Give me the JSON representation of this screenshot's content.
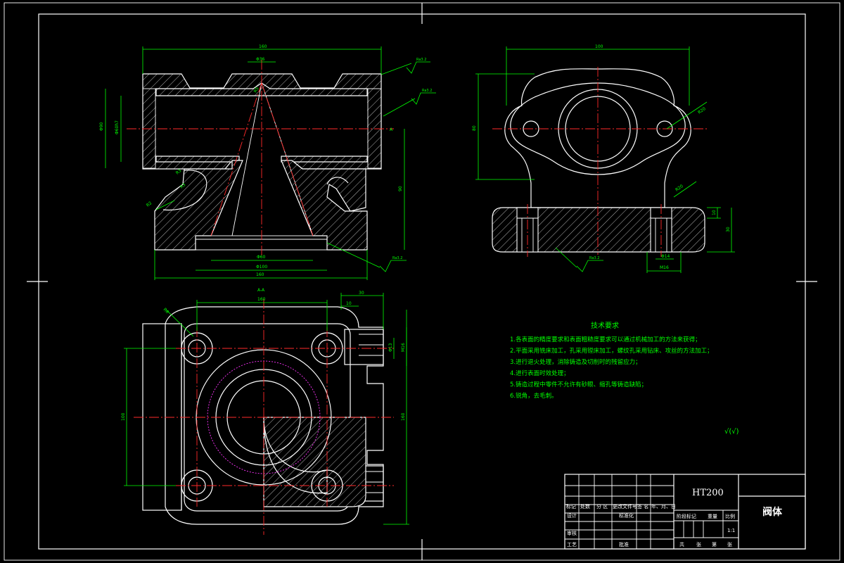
{
  "drawing": {
    "section_label": "A-A",
    "tech_requirements": {
      "title": "技术要求",
      "items": [
        "1.各表面的精度要求和表面粗糙度要求可以通过机械加工的方法来获得；",
        "2.平面采用铣床加工，孔采用镗床加工，螺纹孔采用钻床、攻丝的方法加工；",
        "3.进行退火处理，消除铸造及切削时的残留应力；",
        "4.进行表面时效处理；",
        "5.铸造过程中零件不允许有砂眼、缩孔等铸造缺陷；",
        "6.锐角，去毛刺。"
      ]
    },
    "roughness_note": "√(√)",
    "roughness_marks": [
      "Ra3.2",
      "Ra3.2",
      "Ra3.2",
      "Ra3.2"
    ],
    "dimensions": {
      "front": [
        "160",
        "Φ36",
        "R5",
        "Φ90",
        "Φ60h7",
        "R3",
        "R3",
        "R2",
        "90",
        "Φ60",
        "Φ100",
        "160",
        "A"
      ],
      "side": [
        "100",
        "80",
        "R20",
        "R20",
        "Φ14",
        "M16",
        "10",
        "30"
      ],
      "top": [
        "160",
        "10",
        "30",
        "R8",
        "Φ13",
        "M16",
        "100",
        "160"
      ]
    }
  },
  "title_block": {
    "material": "HT200",
    "part_name": "阀体",
    "headers": [
      "标记",
      "处数",
      "分 区",
      "更改文件号",
      "签 名",
      "年、月、日"
    ],
    "roles": [
      "设计",
      "标准化",
      "审核",
      "工艺",
      "批准"
    ],
    "stage_headers": [
      "阶段标记",
      "重量",
      "比例"
    ],
    "scale": "1:1",
    "sheet_text": [
      "共",
      "张",
      "第",
      "张"
    ]
  }
}
